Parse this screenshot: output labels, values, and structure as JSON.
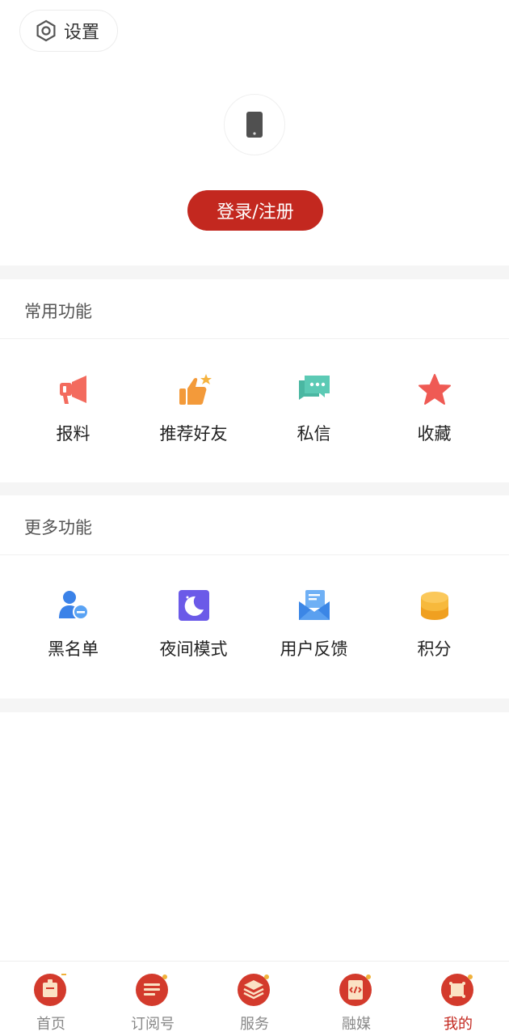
{
  "header": {
    "settings_label": "设置"
  },
  "profile": {
    "login_label": "登录/注册"
  },
  "common": {
    "title": "常用功能",
    "items": [
      {
        "label": "报料",
        "icon": "megaphone-icon"
      },
      {
        "label": "推荐好友",
        "icon": "thumbs-up-icon"
      },
      {
        "label": "私信",
        "icon": "chat-bubble-icon"
      },
      {
        "label": "收藏",
        "icon": "star-icon"
      }
    ]
  },
  "more": {
    "title": "更多功能",
    "items": [
      {
        "label": "黑名单",
        "icon": "user-block-icon"
      },
      {
        "label": "夜间模式",
        "icon": "moon-icon"
      },
      {
        "label": "用户反馈",
        "icon": "envelope-icon"
      },
      {
        "label": "积分",
        "icon": "coins-icon"
      }
    ]
  },
  "tabbar": {
    "items": [
      {
        "label": "首页",
        "icon": "home-icon"
      },
      {
        "label": "订阅号",
        "icon": "subscribe-icon"
      },
      {
        "label": "服务",
        "icon": "service-icon"
      },
      {
        "label": "融媒",
        "icon": "media-icon"
      },
      {
        "label": "我的",
        "icon": "profile-icon"
      }
    ],
    "active_index": 4
  },
  "colors": {
    "brand": "#c3281f",
    "section_bg": "#f5f5f5"
  }
}
